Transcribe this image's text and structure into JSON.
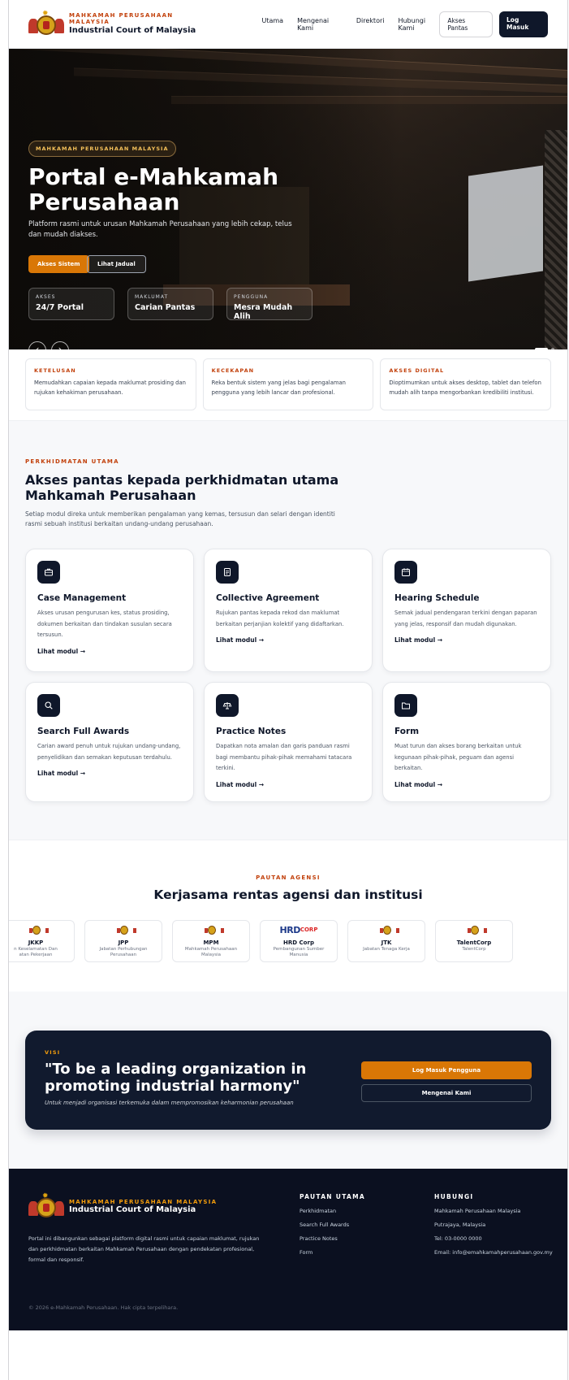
{
  "header": {
    "brand_top": "MAHKAMAH PERUSAHAAN MALAYSIA",
    "brand_name": "Industrial Court of Malaysia",
    "nav": [
      "Utama",
      "Mengenai Kami",
      "Direktori",
      "Hubungi Kami"
    ],
    "quick_access": "Akses Pantas",
    "login": "Log Masuk"
  },
  "hero": {
    "tag": "MAHKAMAH PERUSAHAAN MALAYSIA",
    "title": "Portal e-Mahkamah Perusahaan",
    "subtitle": "Platform rasmi untuk urusan Mahkamah Perusahaan yang lebih cekap, telus dan mudah diakses.",
    "primary_button": "Akses Sistem",
    "secondary_button": "Lihat Jadual",
    "stats": [
      {
        "label": "AKSES",
        "value": "24/7 Portal"
      },
      {
        "label": "MAKLUMAT",
        "value": "Carian Pantas"
      },
      {
        "label": "PENGGUNA",
        "value": "Mesra Mudah Alih"
      }
    ],
    "prev_icon": "‹",
    "next_icon": "›"
  },
  "features": [
    {
      "title": "KETELUSAN",
      "desc": "Memudahkan capaian kepada maklumat prosiding dan rujukan kehakiman perusahaan."
    },
    {
      "title": "KECEKAPAN",
      "desc": "Reka bentuk sistem yang jelas bagi pengalaman pengguna yang lebih lancar dan profesional."
    },
    {
      "title": "AKSES DIGITAL",
      "desc": "Dioptimumkan untuk akses desktop, tablet dan telefon mudah alih tanpa mengorbankan kredibiliti institusi."
    }
  ],
  "services": {
    "eyebrow": "PERKHIDMATAN UTAMA",
    "title": "Akses pantas kepada perkhidmatan utama Mahkamah Perusahaan",
    "lead": "Setiap modul direka untuk memberikan pengalaman yang kemas, tersusun dan selari dengan identiti rasmi sebuah institusi berkaitan undang-undang perusahaan.",
    "link_label": "Lihat modul  →",
    "cards": [
      {
        "icon": "briefcase-icon",
        "title": "Case Management",
        "desc": "Akses urusan pengurusan kes, status prosiding, dokumen berkaitan dan tindakan susulan secara tersusun."
      },
      {
        "icon": "document-icon",
        "title": "Collective Agreement",
        "desc": "Rujukan pantas kepada rekod dan maklumat berkaitan perjanjian kolektif yang didaftarkan."
      },
      {
        "icon": "calendar-icon",
        "title": "Hearing Schedule",
        "desc": "Semak jadual pendengaran terkini dengan paparan yang jelas, responsif dan mudah digunakan."
      },
      {
        "icon": "search-icon",
        "title": "Search Full Awards",
        "desc": "Carian award penuh untuk rujukan undang-undang, penyelidikan dan semakan keputusan terdahulu."
      },
      {
        "icon": "scale-icon",
        "title": "Practice Notes",
        "desc": "Dapatkan nota amalan dan garis panduan rasmi bagi membantu pihak-pihak memahami tatacara terkini."
      },
      {
        "icon": "folder-icon",
        "title": "Form",
        "desc": "Muat turun dan akses borang berkaitan untuk kegunaan pihak-pihak, peguam dan agensi berkaitan."
      }
    ]
  },
  "partners": {
    "eyebrow": "PAUTAN AGENSI",
    "title": "Kerjasama rentas agensi dan institusi",
    "items": [
      {
        "name": "JKKP",
        "full": "n Keselamatan Dan\natan Pekerjaan"
      },
      {
        "name": "JPP",
        "full": "Jabatan Perhubungan\nPerusahaan"
      },
      {
        "name": "MPM",
        "full": "Mahkamah Perusahaan\nMalaysia"
      },
      {
        "name": "HRD Corp",
        "full": "Pembangunan Sumber\nManusia",
        "logo_text": "HRDCORP"
      },
      {
        "name": "JTK",
        "full": "Jabatan Tenaga Kerja"
      },
      {
        "name": "TalentCorp",
        "full": "TalentCorp"
      }
    ]
  },
  "vision": {
    "eyebrow": "VISI",
    "quote": "\"To be a leading organization in promoting industrial harmony\"",
    "translation": "Untuk menjadi organisasi terkemuka dalam mempromosikan keharmonian perusahaan",
    "primary_button": "Log Masuk Pengguna",
    "secondary_button": "Mengenai Kami"
  },
  "footer": {
    "brand_top": "MAHKAMAH PERUSAHAAN MALAYSIA",
    "brand_name": "Industrial Court of Malaysia",
    "desc": "Portal ini dibangunkan sebagai platform digital rasmi untuk capaian maklumat, rujukan dan perkhidmatan berkaitan Mahkamah Perusahaan dengan pendekatan profesional, formal dan responsif.",
    "links_title": "PAUTAN UTAMA",
    "links": [
      "Perkhidmatan",
      "Search Full Awards",
      "Practice Notes",
      "Form"
    ],
    "contact_title": "HUBUNGI",
    "contact": [
      "Mahkamah Perusahaan Malaysia",
      "Putrajaya, Malaysia",
      "Tel: 03-0000 0000",
      "Email: info@emahkamahperusahaan.gov.my"
    ],
    "copyright": "© 2026 e-Mahkamah Perusahaan. Hak cipta terpelihara."
  },
  "colors": {
    "accent": "#d97706",
    "navy": "#0f172a",
    "eyebrow": "#c2410c",
    "footer_bg": "#0b1020"
  }
}
